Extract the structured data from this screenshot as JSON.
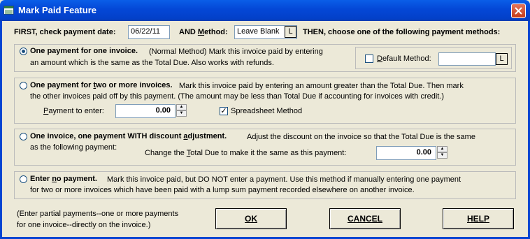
{
  "window": {
    "title": "Mark Paid Feature"
  },
  "top_row": {
    "check_date_label": "FIRST, check payment date:",
    "date_value": "06/22/11",
    "method_label": "AND Method:",
    "method_value": "Leave Blank",
    "method_btn": "L",
    "then_label": "THEN, choose one of the following payment methods:"
  },
  "option1": {
    "title": "One payment for one invoice.",
    "line1": "(Normal Method)  Mark this invoice paid by entering",
    "line2": "an amount which is the same as the Total Due.  Also works with refunds.",
    "selected": true
  },
  "default_method": {
    "label": "Default Method:",
    "value": "",
    "btn": "L",
    "checked": false
  },
  "option2": {
    "title": "One payment for two or more invoices.",
    "line1": "Mark this invoice paid by entering an amount greater than the Total Due.  Then mark",
    "line2": "the other invoices paid off by this payment. (The amount may be less than Total Due if accounting for invoices with credit.)",
    "payment_label": "Payment to enter:",
    "payment_value": "0.00",
    "spreadsheet_label": "Spreadsheet Method",
    "spreadsheet_checked": true
  },
  "option3": {
    "title": "One invoice, one payment WITH discount adjustment.",
    "line1": "Adjust the discount on the invoice so that the Total Due is the same",
    "line2": "as the following payment:",
    "change_label": "Change the Total Due to make it the same as this payment:",
    "change_value": "0.00"
  },
  "option4": {
    "title": "Enter no payment.",
    "line1": "Mark this invoice paid, but DO NOT enter a payment.  Use this method if manually entering one payment",
    "line2": "for two or more invoices which have been paid with a lump sum payment recorded elsewhere on another invoice."
  },
  "footer": {
    "note1": "(Enter partial payments--one or more payments",
    "note2": "for one invoice--directly on the invoice.)",
    "ok": "OK",
    "cancel": "CANCEL",
    "help": "HELP"
  },
  "colors": {
    "titlebar": "#0447d6",
    "face": "#ece9d8",
    "close": "#c73b18"
  }
}
